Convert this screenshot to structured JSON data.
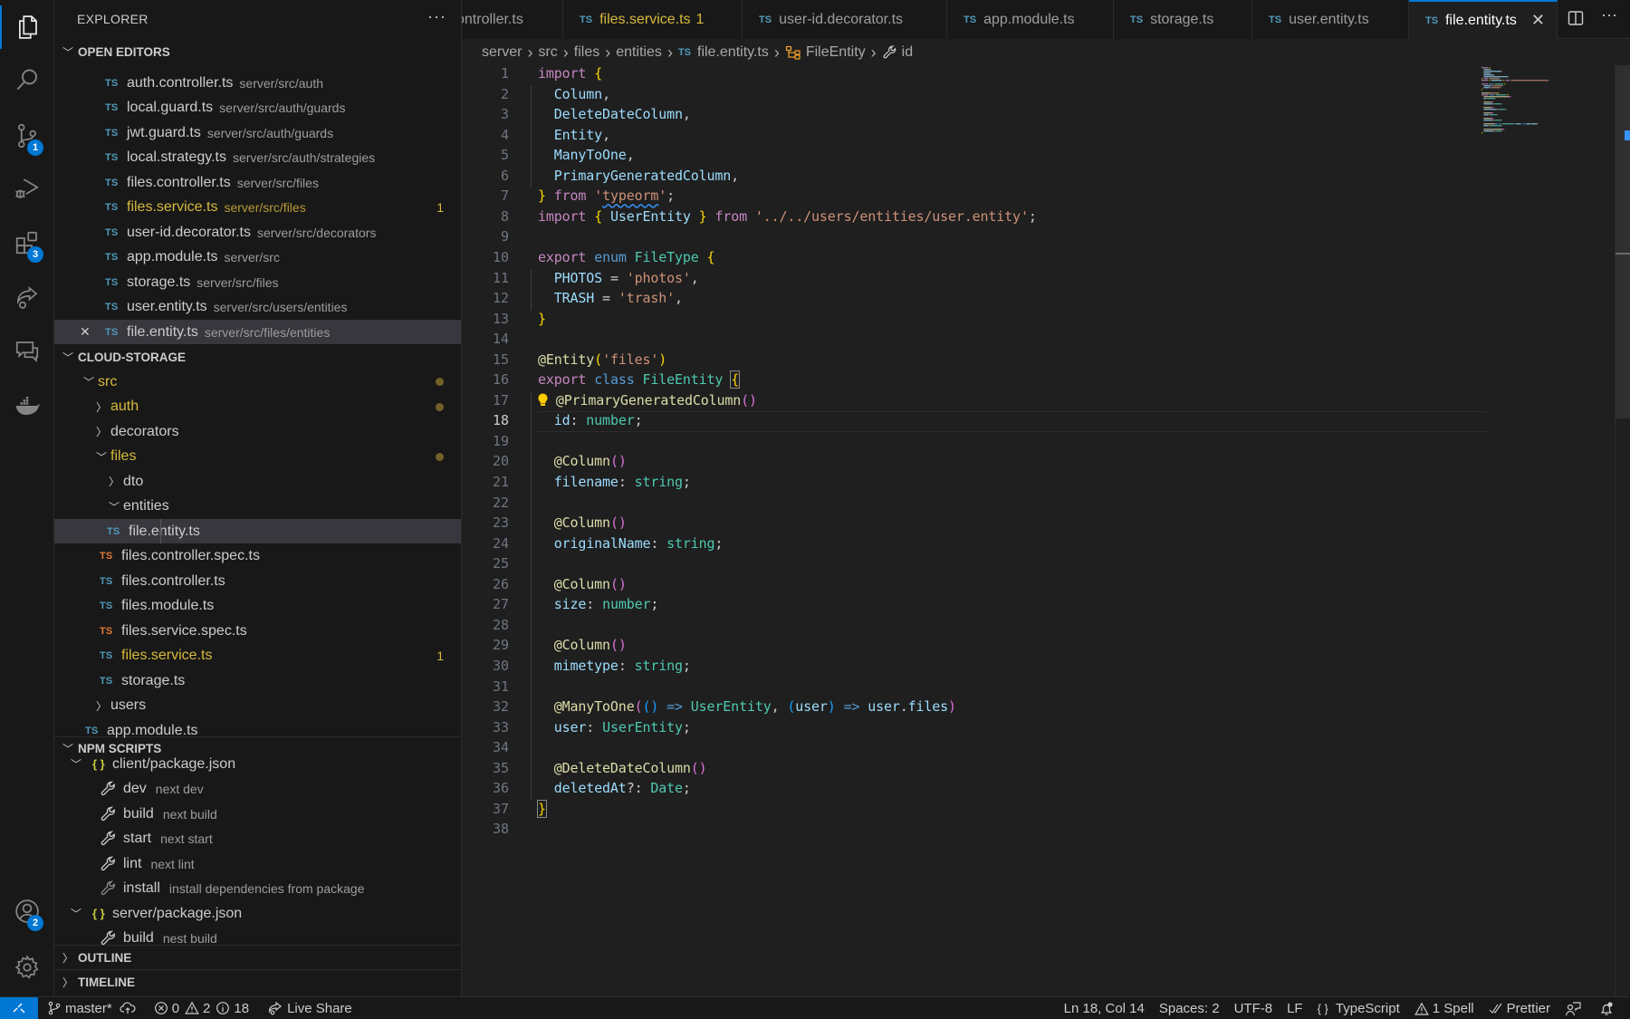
{
  "activity_bar": {
    "items": [
      {
        "name": "explorer",
        "active": true
      },
      {
        "name": "search"
      },
      {
        "name": "source-control",
        "badge": "1"
      },
      {
        "name": "run-and-debug"
      },
      {
        "name": "extensions",
        "badge": "3"
      },
      {
        "name": "live-share"
      },
      {
        "name": "comments"
      },
      {
        "name": "docker"
      }
    ],
    "bottom": [
      {
        "name": "accounts",
        "badge": "2"
      },
      {
        "name": "manage"
      }
    ]
  },
  "sidebar": {
    "title": "EXPLORER",
    "more": "···",
    "open_editors": {
      "header": "OPEN EDITORS",
      "items": [
        {
          "icon": "TS",
          "name": "auth.controller.ts",
          "path": "server/src/auth"
        },
        {
          "icon": "TS",
          "name": "local.guard.ts",
          "path": "server/src/auth/guards"
        },
        {
          "icon": "TS",
          "name": "jwt.guard.ts",
          "path": "server/src/auth/guards"
        },
        {
          "icon": "TS",
          "name": "local.strategy.ts",
          "path": "server/src/auth/strategies"
        },
        {
          "icon": "TS",
          "name": "files.controller.ts",
          "path": "server/src/files"
        },
        {
          "icon": "TS",
          "name": "files.service.ts",
          "path": "server/src/files",
          "problems": "1",
          "modified": true
        },
        {
          "icon": "TS",
          "name": "user-id.decorator.ts",
          "path": "server/src/decorators"
        },
        {
          "icon": "TS",
          "name": "app.module.ts",
          "path": "server/src"
        },
        {
          "icon": "TS",
          "name": "storage.ts",
          "path": "server/src/files"
        },
        {
          "icon": "TS",
          "name": "user.entity.ts",
          "path": "server/src/users/entities"
        },
        {
          "icon": "TS",
          "name": "file.entity.ts",
          "path": "server/src/files/entities",
          "selected": true
        }
      ]
    },
    "project": {
      "header": "CLOUD-STORAGE",
      "tree": [
        {
          "label": "src",
          "type": "folder",
          "expanded": true,
          "modified": true
        },
        {
          "label": "auth",
          "type": "folder",
          "expanded": false,
          "modified": true
        },
        {
          "label": "decorators",
          "type": "folder",
          "expanded": false
        },
        {
          "label": "files",
          "type": "folder",
          "expanded": true,
          "modified": true
        },
        {
          "label": "dto",
          "type": "folder",
          "expanded": false
        },
        {
          "label": "entities",
          "type": "folder",
          "expanded": true
        },
        {
          "label": "file.entity.ts",
          "type": "file",
          "icon": "TS",
          "selected": true
        },
        {
          "label": "files.controller.spec.ts",
          "type": "file",
          "icon": "TS",
          "spec": true
        },
        {
          "label": "files.controller.ts",
          "type": "file",
          "icon": "TS"
        },
        {
          "label": "files.module.ts",
          "type": "file",
          "icon": "TS"
        },
        {
          "label": "files.service.spec.ts",
          "type": "file",
          "icon": "TS",
          "spec": true
        },
        {
          "label": "files.service.ts",
          "type": "file",
          "icon": "TS",
          "modified": true,
          "problems": "1"
        },
        {
          "label": "storage.ts",
          "type": "file",
          "icon": "TS"
        },
        {
          "label": "users",
          "type": "folder",
          "expanded": false
        },
        {
          "label": "app.module.ts",
          "type": "file",
          "icon": "TS"
        }
      ]
    },
    "npm_scripts": {
      "header": "NPM SCRIPTS",
      "packages": [
        {
          "label": "client/package.json",
          "scripts": [
            {
              "name": "dev",
              "command": "next dev"
            },
            {
              "name": "build",
              "command": "next build"
            },
            {
              "name": "start",
              "command": "next start"
            },
            {
              "name": "lint",
              "command": "next lint"
            },
            {
              "name": "install",
              "command": "install dependencies from package"
            }
          ]
        },
        {
          "label": "server/package.json",
          "scripts": [
            {
              "name": "build",
              "command": "nest build"
            }
          ]
        }
      ]
    },
    "outline": {
      "header": "OUTLINE"
    },
    "timeline": {
      "header": "TIMELINE"
    }
  },
  "tabs": [
    {
      "icon": "TS",
      "label": "ontroller.ts",
      "partial": true
    },
    {
      "icon": "TS",
      "label": "files.service.ts",
      "problems": "1",
      "modified": true
    },
    {
      "icon": "TS",
      "label": "user-id.decorator.ts"
    },
    {
      "icon": "TS",
      "label": "app.module.ts"
    },
    {
      "icon": "TS",
      "label": "storage.ts"
    },
    {
      "icon": "TS",
      "label": "user.entity.ts"
    },
    {
      "icon": "TS",
      "label": "file.entity.ts",
      "active": true,
      "close": "✕"
    }
  ],
  "breadcrumb": {
    "parts": [
      "server",
      "src",
      "files",
      "entities"
    ],
    "file_icon": "TS",
    "file": "file.entity.ts",
    "class": "FileEntity",
    "member": "id"
  },
  "editor": {
    "current_line": 18,
    "line_count": 38
  },
  "status_bar": {
    "branch": "master*",
    "errors": "0",
    "warnings": "2",
    "infos": "18",
    "live_share": "Live Share",
    "cursor": "Ln 18, Col 14",
    "indent": "Spaces: 2",
    "encoding": "UTF-8",
    "eol": "LF",
    "language_braces": "{ }",
    "language": "TypeScript",
    "spell": "1 Spell",
    "formatter": "Prettier"
  },
  "colors": {
    "accent": "#0078d4",
    "modified": "#d7ba3c",
    "ts_icon": "#519aba",
    "spec_icon": "#e37933"
  }
}
